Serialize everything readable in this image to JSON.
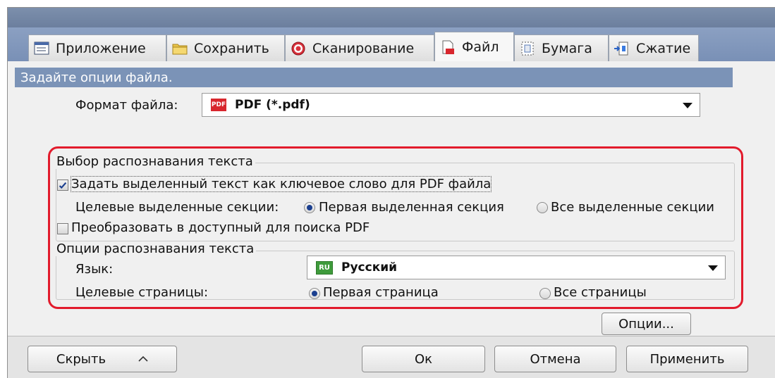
{
  "tabs": [
    {
      "label": "Приложение",
      "icon": "application-icon"
    },
    {
      "label": "Сохранить",
      "icon": "folder-icon"
    },
    {
      "label": "Сканирование",
      "icon": "scan-icon"
    },
    {
      "label": "Файл",
      "icon": "file-icon",
      "active": true
    },
    {
      "label": "Бумага",
      "icon": "paper-icon"
    },
    {
      "label": "Сжатие",
      "icon": "compression-icon"
    }
  ],
  "section_header": "Задайте опции файла.",
  "file_format": {
    "label": "Формат файла:",
    "value": "PDF (*.pdf)",
    "badge": "PDF"
  },
  "ocr_selection": {
    "title": "Выбор распознавания текста",
    "keyword_checkbox": {
      "label": "Задать выделенный текст как ключевое слово для PDF файла",
      "checked": true
    },
    "target_sections_label": "Целевые выделенные секции:",
    "radio_first_section": "Первая выделенная секция",
    "radio_all_sections": "Все выделенные секции",
    "searchable_checkbox": {
      "label": "Преобразовать в доступный для поиска PDF",
      "checked": false
    }
  },
  "ocr_options": {
    "title": "Опции распознавания текста",
    "language_label": "Язык:",
    "language_value": "Русский",
    "language_badge": "RU",
    "pages_label": "Целевые страницы:",
    "radio_first_page": "Первая страница",
    "radio_all_pages": "Все страницы"
  },
  "options_button": "Опции...",
  "footer": {
    "hide": "Скрыть",
    "ok": "Ок",
    "cancel": "Отмена",
    "apply": "Применить"
  },
  "colors": {
    "accent_header": "#7b93b7",
    "tab_strip": "#8ba0c2",
    "highlight_border": "#e21b2c",
    "pdf_badge": "#d8262d",
    "ru_badge": "#3f9b3c"
  }
}
